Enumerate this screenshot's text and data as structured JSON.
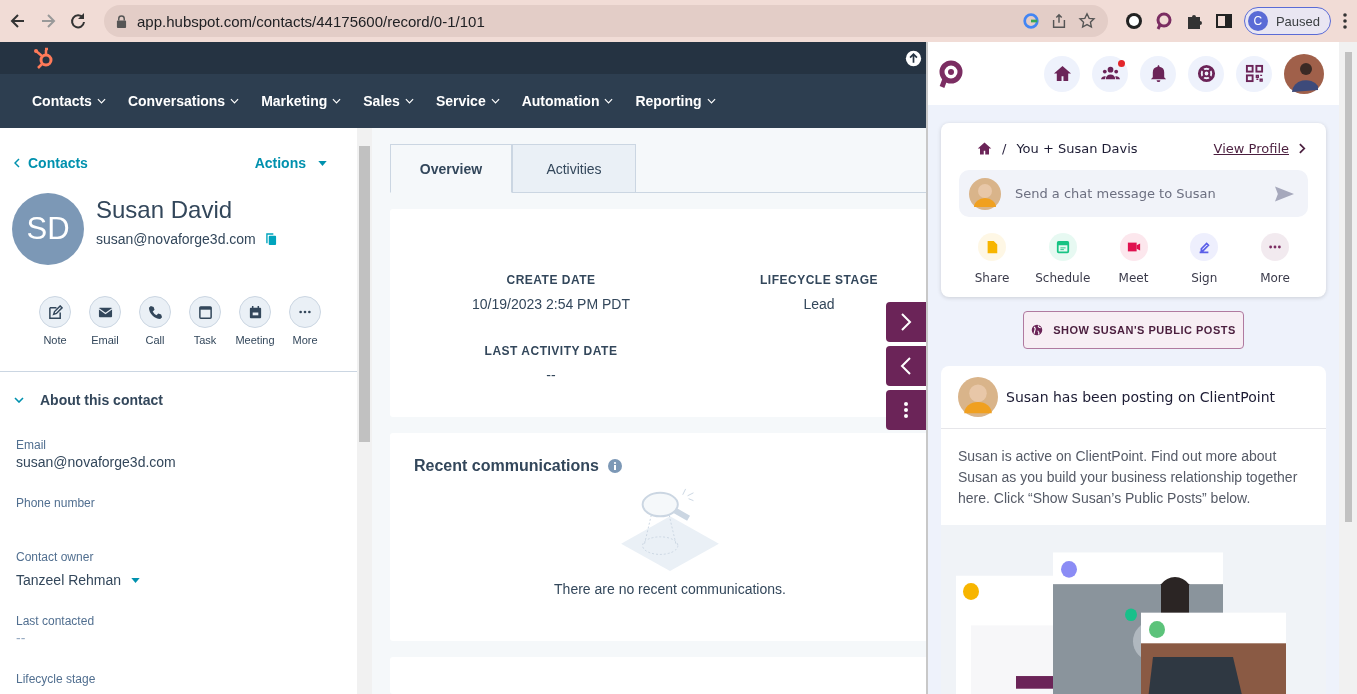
{
  "browser": {
    "url": "app.hubspot.com/contacts/44175600/record/0-1/101",
    "forward_disabled": true,
    "profile_initial": "C",
    "profile_status": "Paused"
  },
  "nav": [
    "Contacts",
    "Conversations",
    "Marketing",
    "Sales",
    "Service",
    "Automation",
    "Reporting"
  ],
  "sidebar": {
    "back_link": "Contacts",
    "actions_menu": "Actions",
    "initials": "SD",
    "name": "Susan David",
    "email": "susan@novaforge3d.com",
    "actions": [
      {
        "kind": "note",
        "label": "Note"
      },
      {
        "kind": "email",
        "label": "Email"
      },
      {
        "kind": "call",
        "label": "Call"
      },
      {
        "kind": "task",
        "label": "Task"
      },
      {
        "kind": "meeting",
        "label": "Meeting"
      },
      {
        "kind": "more",
        "label": "More"
      }
    ],
    "section": {
      "title": "About this contact",
      "expanded": true
    },
    "fields": [
      {
        "kind": "text",
        "label": "Email",
        "value": "susan@novaforge3d.com"
      },
      {
        "kind": "text",
        "label": "Phone number"
      },
      {
        "kind": "dropdown",
        "label": "Contact owner",
        "value": "Tanzeel Rehman"
      },
      {
        "kind": "text",
        "label": "Last contacted",
        "value": "--"
      },
      {
        "kind": "text",
        "label": "Lifecycle stage"
      }
    ]
  },
  "tabs": [
    {
      "label": "Overview",
      "selected": true
    },
    {
      "label": "Activities",
      "selected": false
    }
  ],
  "summary": [
    {
      "label": "CREATE DATE",
      "value": "10/19/2023 2:54 PM PDT"
    },
    {
      "label": "LIFECYCLE STAGE",
      "value": "Lead"
    },
    {
      "label": "LAST ACTIVITY DATE",
      "value": "--"
    }
  ],
  "recent": {
    "title": "Recent communications",
    "empty_text": "There are no recent communications."
  },
  "panel": {
    "header_icons": [
      {
        "kind": "home",
        "badge": false
      },
      {
        "kind": "people",
        "badge": true
      },
      {
        "kind": "bell",
        "badge": false
      },
      {
        "kind": "lifebuoy",
        "badge": false
      },
      {
        "kind": "qr",
        "badge": false
      }
    ],
    "separator": "/",
    "breadcrumb": "You + Susan Davis",
    "view_profile": "View Profile",
    "chat_placeholder": "Send a chat message to Susan",
    "quick_actions": [
      {
        "kind": "share",
        "label": "Share",
        "color": "#f7b500"
      },
      {
        "kind": "schedule",
        "label": "Schedule",
        "color": "#17c383"
      },
      {
        "kind": "meet",
        "label": "Meet",
        "color": "#e0114f"
      },
      {
        "kind": "sign",
        "label": "Sign",
        "color": "#5a5ee8"
      },
      {
        "kind": "more",
        "label": "More",
        "color": "#7b2d62"
      }
    ],
    "show_posts": "SHOW SUSAN'S PUBLIC POSTS",
    "posting_title": "Susan has been posting on ClientPoint",
    "posting_text": "Susan is active on ClientPoint. Find out more about Susan as you build your business relationship together here. Click “Show Susan’s Public Posts” below."
  }
}
